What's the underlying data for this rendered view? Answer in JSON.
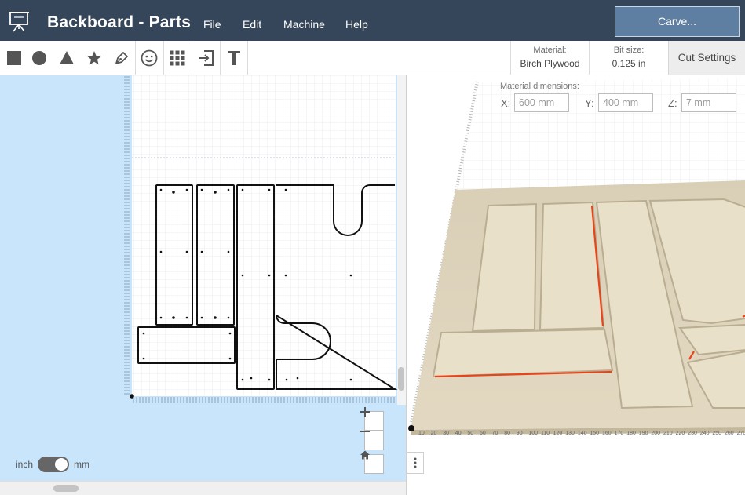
{
  "header": {
    "title": "Backboard - Parts",
    "menu": [
      "File",
      "Edit",
      "Machine",
      "Help"
    ],
    "carve_label": "Carve...",
    "logo_icon": "easel-icon"
  },
  "toolbar": {
    "tools": [
      {
        "name": "square-icon"
      },
      {
        "name": "circle-icon"
      },
      {
        "name": "triangle-icon"
      },
      {
        "name": "star-icon"
      },
      {
        "name": "pen-icon"
      },
      {
        "name": "smiley-icon"
      },
      {
        "name": "grid-apps-icon"
      },
      {
        "name": "import-icon"
      },
      {
        "name": "text-icon"
      }
    ],
    "material_label": "Material:",
    "material_value": "Birch Plywood",
    "bit_label": "Bit size:",
    "bit_value": "0.125 in",
    "cut_settings_label": "Cut Settings"
  },
  "design": {
    "unit_left": "inch",
    "unit_right": "mm",
    "unit_selected": "mm"
  },
  "preview": {
    "material_dims_label": "Material dimensions:",
    "x_label": "X:",
    "x_value": "600 mm",
    "y_label": "Y:",
    "y_value": "400 mm",
    "z_label": "Z:",
    "z_value": "7 mm",
    "x_axis_ticks": [
      "10",
      "20",
      "30",
      "40",
      "50",
      "60",
      "70",
      "80",
      "90",
      "100",
      "110",
      "120",
      "130",
      "140",
      "150",
      "160",
      "170",
      "180",
      "190",
      "200",
      "210",
      "220",
      "230",
      "240",
      "250",
      "260",
      "270"
    ]
  },
  "colors": {
    "header_bg": "#35465a",
    "carve_bg": "#5f7fa2",
    "design_bg": "#c8e5fb",
    "wood": "#e6dcc4",
    "cut_highlight": "#e8441a"
  }
}
